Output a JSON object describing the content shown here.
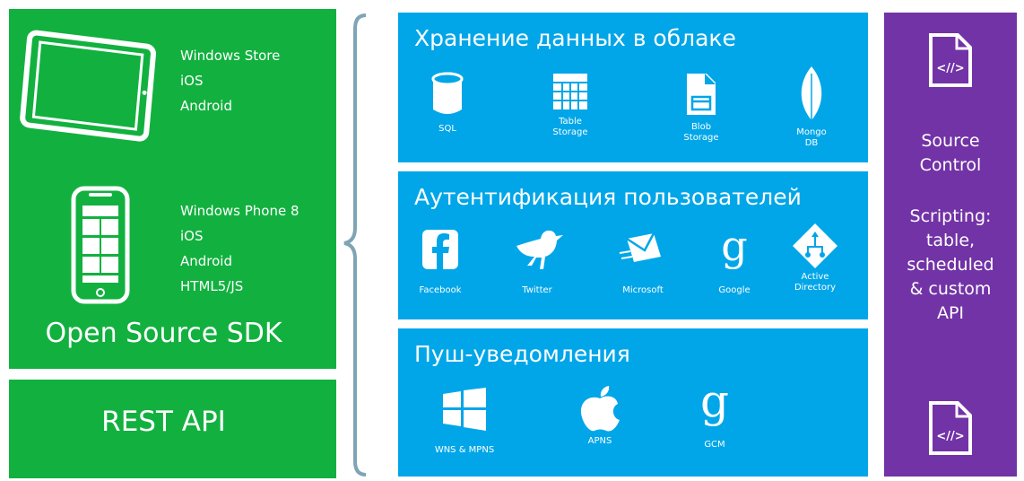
{
  "colors": {
    "green": "#12b13f",
    "blue": "#00a6e8",
    "purple": "#7233a6",
    "brace": "#7fa4b5"
  },
  "left": {
    "tablet_platforms": [
      "Windows Store",
      "iOS",
      "Android"
    ],
    "phone_platforms": [
      "Windows Phone 8",
      "iOS",
      "Android",
      "HTML5/JS"
    ],
    "sdk_title": "Open Source SDK",
    "rest_title": "REST API",
    "icons": [
      "tablet-icon",
      "windows-phone-icon"
    ]
  },
  "storage": {
    "title": "Хранение данных в облаке",
    "items": [
      {
        "label": "SQL",
        "icon": "database-icon"
      },
      {
        "label": "Table\nStorage",
        "icon": "table-icon"
      },
      {
        "label": "Blob\nStorage",
        "icon": "blob-file-icon"
      },
      {
        "label": "Mongo\nDB",
        "icon": "mongodb-leaf-icon"
      }
    ]
  },
  "auth": {
    "title": "Аутентификация пользователей",
    "items": [
      {
        "label": "Facebook",
        "icon": "facebook-icon"
      },
      {
        "label": "Twitter",
        "icon": "twitter-bird-icon"
      },
      {
        "label": "Microsoft",
        "icon": "microsoft-envelope-icon"
      },
      {
        "label": "Google",
        "icon": "google-g-icon"
      },
      {
        "label": "Active\nDirectory",
        "icon": "active-directory-icon"
      }
    ]
  },
  "push": {
    "title": "Пуш-уведомления",
    "items": [
      {
        "label": "WNS & MPNS",
        "icon": "windows-logo-icon"
      },
      {
        "label": "APNS",
        "icon": "apple-icon"
      },
      {
        "label": "GCM",
        "icon": "google-g-icon"
      }
    ]
  },
  "source": {
    "source_control": "Source\nControl",
    "scripting": "Scripting:\ntable,\nscheduled\n& custom\nAPI",
    "icons": [
      "code-file-icon",
      "code-file-icon"
    ]
  }
}
